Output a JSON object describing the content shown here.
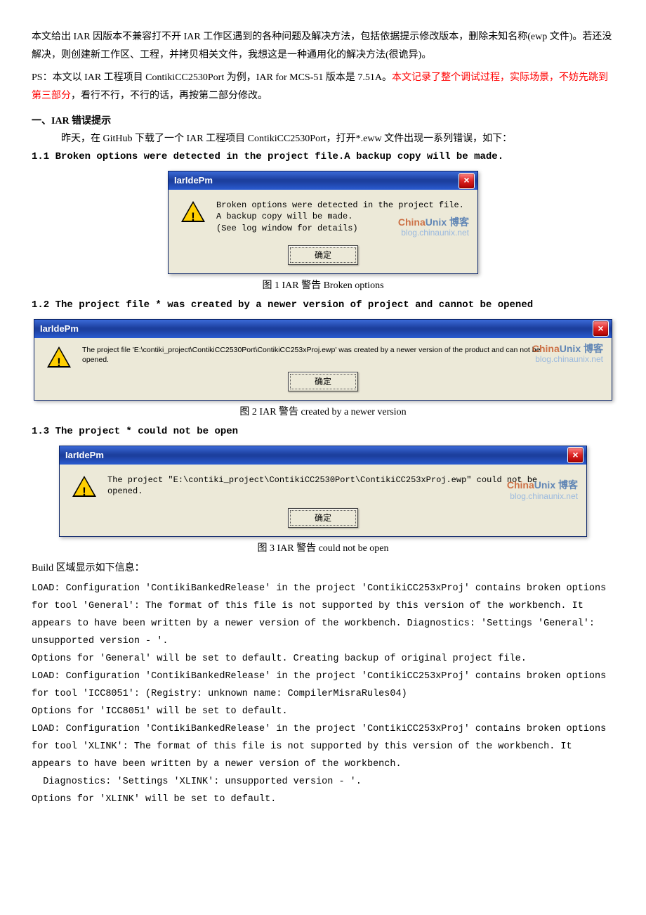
{
  "intro": {
    "p1": "本文给出 IAR 因版本不兼容打不开 IAR 工作区遇到的各种问题及解决方法，包括依据提示修改版本，删除未知名称(ewp 文件)。若还没解决，则创建新工作区、工程，并拷贝相关文件，我想这是一种通用化的解决方法(很诡异)。",
    "p2a": "PS：本文以 IAR 工程项目 ContikiCC2530Port 为例，IAR for MCS-51 版本是 7.51A。",
    "p2b": "本文记录了整个调试过程，实际场景，不妨先跳到第三部分",
    "p2c": "，看行不行，不行的话，再按第二部分修改。"
  },
  "section1": {
    "header": "一、IAR 错误提示",
    "lead": "昨天，在 GitHub 下载了一个 IAR 工程项目 ContikiCC2530Port，打开*.eww 文件出现一系列错误，如下：",
    "h11": "1.1 Broken options were detected in the project file.A backup copy will be made.",
    "h12": "1.2 The project file * was created by a newer version of project and cannot be opened",
    "h13": "1.3 The project * could not be open"
  },
  "dialog": {
    "title": "IarIdePm",
    "close": "×",
    "ok": "确定",
    "wm_brand_left": "China",
    "wm_brand_right": "Unix",
    "wm_brand_tail": " 博客",
    "wm_url": "blog.chinaunix.net",
    "msg1a": "Broken options were detected in the project file.",
    "msg1b": "A backup copy will be made.",
    "msg1c": "(See log window for details)",
    "msg2": "The project file 'E:\\contiki_project\\ContikiCC2530Port\\ContikiCC253xProj.ewp' was created by a newer version of the product and can not be opened.",
    "msg3": "The project \"E:\\contiki_project\\ContikiCC2530Port\\ContikiCC253xProj.ewp\" could not be opened."
  },
  "captions": {
    "c1": "图 1 IAR 警告 Broken options",
    "c2": "图 2 IAR 警告 created by a newer version",
    "c3": "图 3 IAR 警告 could not be open"
  },
  "build": {
    "lead": "Build 区域显示如下信息：",
    "l1": "LOAD: Configuration 'ContikiBankedRelease' in the project 'ContikiCC253xProj' contains broken options for tool 'General':  The format of this file is not supported by this version of the workbench. It appears to have been written by a newer version of the workbench. Diagnostics: 'Settings 'General': unsupported version - '.",
    "l2": "Options for 'General' will be set to default. Creating backup of original project file.",
    "l3": "LOAD: Configuration 'ContikiBankedRelease' in the project 'ContikiCC253xProj' contains broken options for tool 'ICC8051': (Registry: unknown name: CompilerMisraRules04)",
    "l4": "Options for 'ICC8051' will be set to default.",
    "l5": "LOAD: Configuration 'ContikiBankedRelease' in the project 'ContikiCC253xProj' contains broken options for tool 'XLINK': The format of this file is not supported by this version of the workbench. It appears to have been written by a newer version of the workbench.",
    "l6": "Diagnostics: 'Settings 'XLINK': unsupported version - '.",
    "l7": "Options for 'XLINK' will be set to default."
  }
}
